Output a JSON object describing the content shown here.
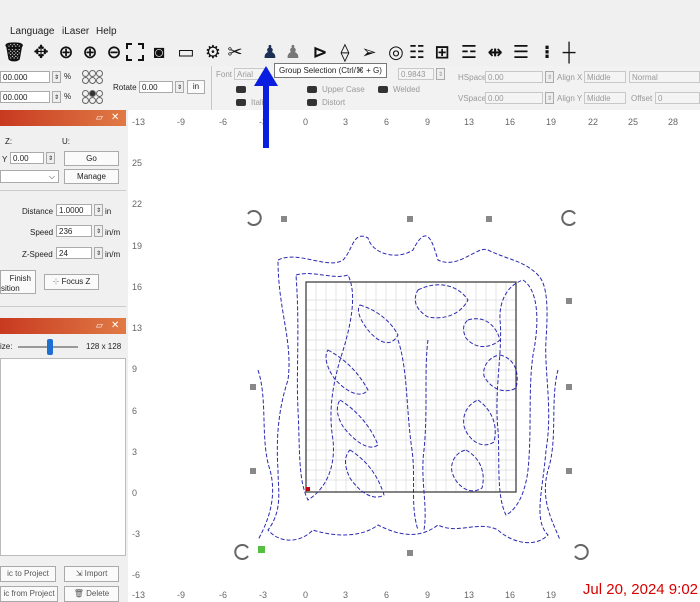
{
  "menu": [
    "Language",
    "iLaser",
    "Help"
  ],
  "toolbar": {
    "icons": [
      "trash-icon",
      "move-icon",
      "zoom-icon",
      "zoom-in-icon",
      "zoom-out-icon",
      "frame-select-icon",
      "camera-icon",
      "monitor-icon",
      "gear-icon",
      "tools-icon",
      "group-icon",
      "ungroup-icon",
      "flip-icon",
      "mirror-icon",
      "send-icon",
      "target-icon",
      "align-icon",
      "distribute-icon",
      "array-icon",
      "space-icon",
      "grid-icon",
      "center-icon"
    ],
    "tooltip": "Group Selection (Ctrl/⌘ + G)"
  },
  "props": {
    "x_value": "00.000",
    "y_value": "00.000",
    "percent": "%",
    "rotate_label": "Rotate",
    "rotate_value": "0.00",
    "in_label": "in",
    "font_label": "Font",
    "font_value": "Arial",
    "height_value": "0.9843",
    "upper_case": "Upper Case",
    "welded": "Welded",
    "italic": "Italic",
    "distort": "Distort",
    "hspace_label": "HSpace",
    "hspace_value": "0.00",
    "vspace_label": "VSpace",
    "vspace_value": "0.00",
    "alignx_label": "Align X",
    "alignx_value": "Middle",
    "normal_value": "Normal",
    "aligny_label": "Align Y",
    "aligny_value": "Middle",
    "offset_label": "Offset",
    "offset_value": "0"
  },
  "left_panel": {
    "z_label": "Z:",
    "u_label": "U:",
    "y_prefix": "Y",
    "y_value": "0.00",
    "go": "Go",
    "manage": "Manage",
    "distance_label": "Distance",
    "distance_value": "1.0000",
    "distance_unit": "in",
    "speed_label": "Speed",
    "speed_value": "236",
    "speed_unit": "in/m",
    "zspeed_label": "Z-Speed",
    "zspeed_value": "24",
    "zspeed_unit": "in/m",
    "finish_label": "Finish",
    "sition_label": "sition",
    "focus_label": "Focus Z",
    "size_label": "ize:",
    "size_value": "128 x 128",
    "to_project": "ic to Project",
    "import": "Import",
    "from_project": "ic from Project",
    "delete": "Delete"
  },
  "ruler": {
    "top": [
      "-13",
      "-9",
      "-6",
      "-3",
      "0",
      "3",
      "6",
      "9",
      "13",
      "16",
      "19",
      "22",
      "25",
      "28"
    ],
    "left": [
      "25",
      "22",
      "19",
      "16",
      "13",
      "9",
      "6",
      "3",
      "0",
      "-3",
      "-6"
    ],
    "bottom": [
      "-13",
      "-9",
      "-6",
      "-3",
      "0",
      "3",
      "6",
      "9",
      "13",
      "16",
      "19"
    ]
  },
  "timestamp": "Jul 20, 2024 9:02"
}
